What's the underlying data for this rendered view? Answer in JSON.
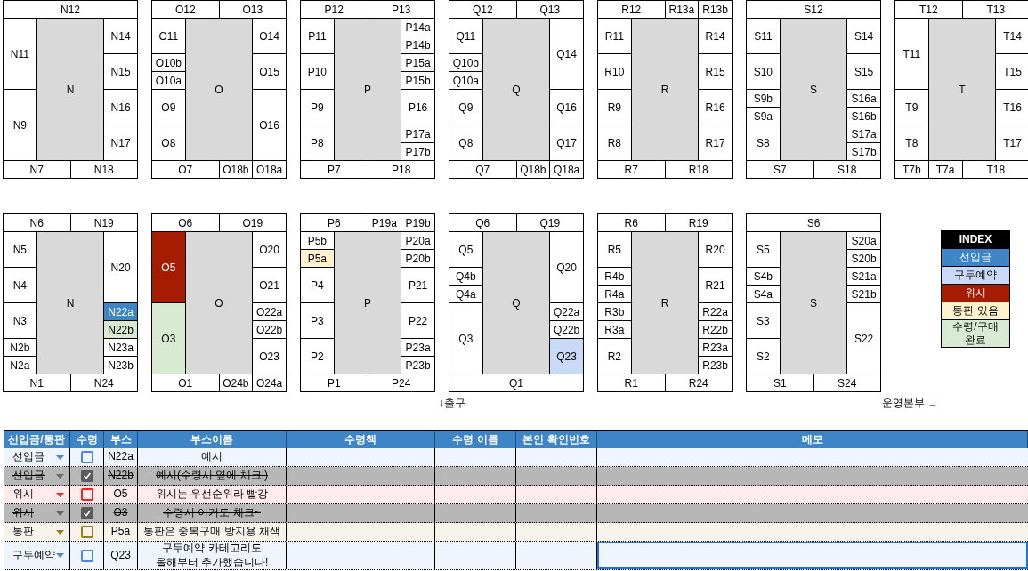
{
  "blocks_upper": [
    {
      "name": "N",
      "top": [
        {
          "label": "N12",
          "kind": "full"
        }
      ],
      "left": [
        {
          "label": "N11",
          "kind": "double"
        },
        {
          "label": "N9",
          "kind": "double"
        }
      ],
      "right": [
        {
          "label": "N14",
          "kind": "slot"
        },
        {
          "label": "N15",
          "kind": "slot"
        },
        {
          "label": "N16",
          "kind": "slot"
        },
        {
          "label": "N17",
          "kind": "slot"
        }
      ],
      "bottom": [
        {
          "label": "N7",
          "kind": "wide"
        },
        {
          "label": "N18",
          "kind": "wide"
        }
      ]
    },
    {
      "name": "O",
      "top": [
        {
          "label": "O12",
          "kind": "wide"
        },
        {
          "label": "O13",
          "kind": "wide"
        }
      ],
      "left": [
        {
          "label": "O11",
          "kind": "slot"
        },
        {
          "label": "O10b",
          "kind": "half"
        },
        {
          "label": "O10a",
          "kind": "half"
        },
        {
          "label": "O9",
          "kind": "slot"
        },
        {
          "label": "O8",
          "kind": "slot"
        }
      ],
      "right": [
        {
          "label": "O14",
          "kind": "slot"
        },
        {
          "label": "O15",
          "kind": "slot"
        },
        {
          "label": "O16",
          "kind": "double"
        }
      ],
      "bottom": [
        {
          "label": "O7",
          "kind": "wide"
        },
        {
          "label": "O18b",
          "kind": "single"
        },
        {
          "label": "O18a",
          "kind": "single"
        }
      ]
    },
    {
      "name": "P",
      "top": [
        {
          "label": "P12",
          "kind": "wide"
        },
        {
          "label": "P13",
          "kind": "wide"
        }
      ],
      "left": [
        {
          "label": "P11",
          "kind": "slot"
        },
        {
          "label": "P10",
          "kind": "slot"
        },
        {
          "label": "P9",
          "kind": "slot"
        },
        {
          "label": "P8",
          "kind": "slot"
        }
      ],
      "right": [
        {
          "label": "P14a",
          "kind": "half"
        },
        {
          "label": "P14b",
          "kind": "half"
        },
        {
          "label": "P15a",
          "kind": "half"
        },
        {
          "label": "P15b",
          "kind": "half"
        },
        {
          "label": "P16",
          "kind": "slot"
        },
        {
          "label": "P17a",
          "kind": "half"
        },
        {
          "label": "P17b",
          "kind": "half"
        }
      ],
      "bottom": [
        {
          "label": "P7",
          "kind": "wide"
        },
        {
          "label": "P18",
          "kind": "wide"
        }
      ]
    },
    {
      "name": "Q",
      "top": [
        {
          "label": "Q12",
          "kind": "wide"
        },
        {
          "label": "Q13",
          "kind": "wide"
        }
      ],
      "left": [
        {
          "label": "Q11",
          "kind": "slot"
        },
        {
          "label": "Q10b",
          "kind": "half"
        },
        {
          "label": "Q10a",
          "kind": "half"
        },
        {
          "label": "Q9",
          "kind": "slot"
        },
        {
          "label": "Q8",
          "kind": "slot"
        }
      ],
      "right": [
        {
          "label": "Q14",
          "kind": "double"
        },
        {
          "label": "Q16",
          "kind": "slot"
        },
        {
          "label": "Q17",
          "kind": "slot"
        }
      ],
      "bottom": [
        {
          "label": "Q7",
          "kind": "wide"
        },
        {
          "label": "Q18b",
          "kind": "single"
        },
        {
          "label": "Q18a",
          "kind": "single"
        }
      ]
    },
    {
      "name": "R",
      "top": [
        {
          "label": "R12",
          "kind": "wide"
        },
        {
          "label": "R13a",
          "kind": "single"
        },
        {
          "label": "R13b",
          "kind": "single"
        }
      ],
      "left": [
        {
          "label": "R11",
          "kind": "slot"
        },
        {
          "label": "R10",
          "kind": "slot"
        },
        {
          "label": "R9",
          "kind": "slot"
        },
        {
          "label": "R8",
          "kind": "slot"
        }
      ],
      "right": [
        {
          "label": "R14",
          "kind": "slot"
        },
        {
          "label": "R15",
          "kind": "slot"
        },
        {
          "label": "R16",
          "kind": "slot"
        },
        {
          "label": "R17",
          "kind": "slot"
        }
      ],
      "bottom": [
        {
          "label": "R7",
          "kind": "wide"
        },
        {
          "label": "R18",
          "kind": "wide"
        }
      ]
    },
    {
      "name": "S",
      "top": [
        {
          "label": "S12",
          "kind": "full"
        }
      ],
      "left": [
        {
          "label": "S11",
          "kind": "slot"
        },
        {
          "label": "S10",
          "kind": "slot"
        },
        {
          "label": "S9b",
          "kind": "half"
        },
        {
          "label": "S9a",
          "kind": "half"
        },
        {
          "label": "S8",
          "kind": "slot"
        }
      ],
      "right": [
        {
          "label": "S14",
          "kind": "slot"
        },
        {
          "label": "S15",
          "kind": "slot"
        },
        {
          "label": "S16a",
          "kind": "half"
        },
        {
          "label": "S16b",
          "kind": "half"
        },
        {
          "label": "S17a",
          "kind": "half"
        },
        {
          "label": "S17b",
          "kind": "half"
        }
      ],
      "bottom": [
        {
          "label": "S7",
          "kind": "wide"
        },
        {
          "label": "S18",
          "kind": "wide"
        }
      ]
    },
    {
      "name": "T",
      "top": [
        {
          "label": "T12",
          "kind": "wide"
        },
        {
          "label": "T13",
          "kind": "wide"
        }
      ],
      "left": [
        {
          "label": "T11",
          "kind": "double"
        },
        {
          "label": "T9",
          "kind": "slot"
        },
        {
          "label": "T8",
          "kind": "slot"
        }
      ],
      "right": [
        {
          "label": "T14",
          "kind": "slot"
        },
        {
          "label": "T15",
          "kind": "slot"
        },
        {
          "label": "T16",
          "kind": "slot"
        },
        {
          "label": "T17",
          "kind": "slot"
        }
      ],
      "bottom": [
        {
          "label": "T7b",
          "kind": "single"
        },
        {
          "label": "T7a",
          "kind": "single"
        },
        {
          "label": "T18",
          "kind": "wide"
        }
      ]
    }
  ],
  "blocks_lower": [
    {
      "name": "N",
      "top": [
        {
          "label": "N6",
          "kind": "wide"
        },
        {
          "label": "N19",
          "kind": "wide"
        }
      ],
      "left": [
        {
          "label": "N5",
          "kind": "slot"
        },
        {
          "label": "N4",
          "kind": "slot"
        },
        {
          "label": "N3",
          "kind": "slot"
        },
        {
          "label": "N2b",
          "kind": "half"
        },
        {
          "label": "N2a",
          "kind": "half"
        }
      ],
      "right": [
        {
          "label": "N20",
          "kind": "double"
        },
        {
          "label": "N22a",
          "kind": "half",
          "color": "#3d85c6"
        },
        {
          "label": "N22b",
          "kind": "half",
          "color": "#d9ead3"
        },
        {
          "label": "N23a",
          "kind": "half"
        },
        {
          "label": "N23b",
          "kind": "half"
        }
      ],
      "bottom": [
        {
          "label": "N1",
          "kind": "wide"
        },
        {
          "label": "N24",
          "kind": "wide"
        }
      ]
    },
    {
      "name": "O",
      "top": [
        {
          "label": "O6",
          "kind": "wide"
        },
        {
          "label": "O19",
          "kind": "wide"
        }
      ],
      "left": [
        {
          "label": "O5",
          "kind": "double",
          "color": "#a61c00"
        },
        {
          "label": "O3",
          "kind": "double",
          "color": "#d9ead3"
        }
      ],
      "right": [
        {
          "label": "O20",
          "kind": "slot"
        },
        {
          "label": "O21",
          "kind": "slot"
        },
        {
          "label": "O22a",
          "kind": "half"
        },
        {
          "label": "O22b",
          "kind": "half"
        },
        {
          "label": "O23",
          "kind": "slot"
        }
      ],
      "bottom": [
        {
          "label": "O1",
          "kind": "wide"
        },
        {
          "label": "O24b",
          "kind": "single"
        },
        {
          "label": "O24a",
          "kind": "single"
        }
      ]
    },
    {
      "name": "P",
      "top": [
        {
          "label": "P6",
          "kind": "wide"
        },
        {
          "label": "P19a",
          "kind": "single"
        },
        {
          "label": "P19b",
          "kind": "single"
        }
      ],
      "left": [
        {
          "label": "P5b",
          "kind": "half"
        },
        {
          "label": "P5a",
          "kind": "half",
          "color": "#fff2cc"
        },
        {
          "label": "P4",
          "kind": "slot"
        },
        {
          "label": "P3",
          "kind": "slot"
        },
        {
          "label": "P2",
          "kind": "slot"
        }
      ],
      "right": [
        {
          "label": "P20a",
          "kind": "half"
        },
        {
          "label": "P20b",
          "kind": "half"
        },
        {
          "label": "P21",
          "kind": "slot"
        },
        {
          "label": "P22",
          "kind": "slot"
        },
        {
          "label": "P23a",
          "kind": "half"
        },
        {
          "label": "P23b",
          "kind": "half"
        }
      ],
      "bottom": [
        {
          "label": "P1",
          "kind": "wide"
        },
        {
          "label": "P24",
          "kind": "wide"
        }
      ]
    },
    {
      "name": "Q",
      "top": [
        {
          "label": "Q6",
          "kind": "wide"
        },
        {
          "label": "Q19",
          "kind": "wide"
        }
      ],
      "left": [
        {
          "label": "Q5",
          "kind": "slot"
        },
        {
          "label": "Q4b",
          "kind": "half"
        },
        {
          "label": "Q4a",
          "kind": "half"
        },
        {
          "label": "Q3",
          "kind": "double"
        }
      ],
      "right": [
        {
          "label": "Q20",
          "kind": "double"
        },
        {
          "label": "Q22a",
          "kind": "half"
        },
        {
          "label": "Q22b",
          "kind": "half"
        },
        {
          "label": "Q23",
          "kind": "slot",
          "color": "#c9daf8"
        }
      ],
      "bottom": [
        {
          "label": "Q1",
          "kind": "full"
        }
      ]
    },
    {
      "name": "R",
      "top": [
        {
          "label": "R6",
          "kind": "wide"
        },
        {
          "label": "R19",
          "kind": "wide"
        }
      ],
      "left": [
        {
          "label": "R5",
          "kind": "slot"
        },
        {
          "label": "R4b",
          "kind": "half"
        },
        {
          "label": "R4a",
          "kind": "half"
        },
        {
          "label": "R3b",
          "kind": "half"
        },
        {
          "label": "R3a",
          "kind": "half"
        },
        {
          "label": "R2",
          "kind": "slot"
        }
      ],
      "right": [
        {
          "label": "R20",
          "kind": "slot"
        },
        {
          "label": "R21",
          "kind": "slot"
        },
        {
          "label": "R22a",
          "kind": "half"
        },
        {
          "label": "R22b",
          "kind": "half"
        },
        {
          "label": "R23a",
          "kind": "half"
        },
        {
          "label": "R23b",
          "kind": "half"
        }
      ],
      "bottom": [
        {
          "label": "R1",
          "kind": "wide"
        },
        {
          "label": "R24",
          "kind": "wide"
        }
      ]
    },
    {
      "name": "S",
      "top": [
        {
          "label": "S6",
          "kind": "full"
        }
      ],
      "left": [
        {
          "label": "S5",
          "kind": "slot"
        },
        {
          "label": "S4b",
          "kind": "half"
        },
        {
          "label": "S4a",
          "kind": "half"
        },
        {
          "label": "S3",
          "kind": "slot"
        },
        {
          "label": "S2",
          "kind": "slot"
        }
      ],
      "right": [
        {
          "label": "S20a",
          "kind": "half"
        },
        {
          "label": "S20b",
          "kind": "half"
        },
        {
          "label": "S21a",
          "kind": "half"
        },
        {
          "label": "S21b",
          "kind": "half"
        },
        {
          "label": "S22",
          "kind": "double"
        }
      ],
      "bottom": [
        {
          "label": "S1",
          "kind": "wide"
        },
        {
          "label": "S24",
          "kind": "wide"
        }
      ]
    }
  ],
  "legend": {
    "title": "INDEX",
    "items": [
      {
        "label": "선입금",
        "color": "#3d85c6"
      },
      {
        "label": "구두예약",
        "color": "#c9daf8"
      },
      {
        "label": "위시",
        "color": "#a61c00"
      },
      {
        "label": "통판 있음",
        "color": "#fff2cc"
      },
      {
        "label": "수령/구매\n완료",
        "color": "#d9ead3"
      }
    ]
  },
  "exit_label": "↓출구",
  "office_label": "운영본부 →",
  "table": {
    "columns": [
      "선입금/통판",
      "수령",
      "부스",
      "부스이름",
      "수령책",
      "수령 이름",
      "본인 확인번호",
      "메모"
    ],
    "rows": [
      {
        "category": "선입금",
        "color": "#4a86e8",
        "checked": false,
        "booth": "N22a",
        "booth_name": "예시",
        "selected": false
      },
      {
        "category": "선입금",
        "checked": true,
        "booth": "N22b",
        "booth_name": "예시(수령시 옆에 체크!)",
        "selected": false
      },
      {
        "category": "위시",
        "color": "#ff2020",
        "checked": false,
        "booth": "O5",
        "booth_name": "위시는 우선순위라 빨강",
        "selected": false
      },
      {
        "category": "위시",
        "checked": true,
        "booth": "O3",
        "booth_name": "수령시 이거도 체크~",
        "selected": false
      },
      {
        "category": "통판",
        "color": "#a07a1e",
        "checked": false,
        "booth": "P5a",
        "booth_name": "통판은 중복구매 방지용 채색",
        "selected": false
      },
      {
        "category": "구두예약",
        "color": "#4a86e8",
        "checked": false,
        "booth": "Q23",
        "booth_name": "구두예약 카테고리도\n올해부터 추가했습니다!",
        "selected": true
      }
    ]
  }
}
